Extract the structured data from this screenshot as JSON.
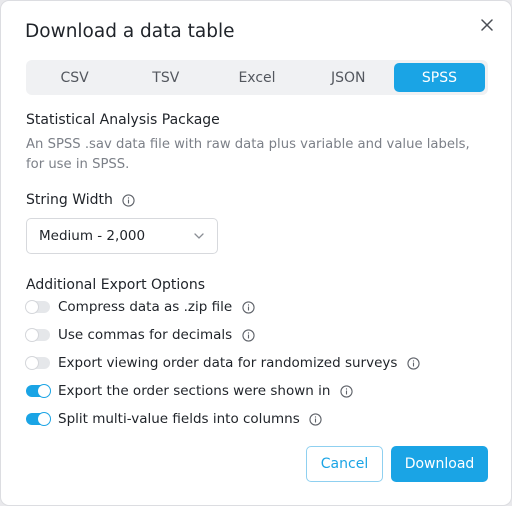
{
  "dialog": {
    "title": "Download a data table",
    "close_icon": "close-icon"
  },
  "tabs": [
    {
      "label": "CSV",
      "active": false
    },
    {
      "label": "TSV",
      "active": false
    },
    {
      "label": "Excel",
      "active": false
    },
    {
      "label": "JSON",
      "active": false
    },
    {
      "label": "SPSS",
      "active": true
    }
  ],
  "format": {
    "title": "Statistical Analysis Package",
    "description": "An SPSS .sav data file with raw data plus variable and value labels, for use in SPSS."
  },
  "string_width": {
    "label": "String Width",
    "selected": "Medium - 2,000"
  },
  "export_options": {
    "title": "Additional Export Options",
    "items": [
      {
        "label": "Compress data as .zip file",
        "on": false
      },
      {
        "label": "Use commas for decimals",
        "on": false
      },
      {
        "label": "Export viewing order data for randomized surveys",
        "on": false
      },
      {
        "label": "Export the order sections were shown in",
        "on": true
      },
      {
        "label": "Split multi-value fields into columns",
        "on": true
      }
    ]
  },
  "buttons": {
    "cancel": "Cancel",
    "download": "Download"
  },
  "colors": {
    "accent": "#1aa4e5",
    "toggle_off": "#e5e7ea"
  }
}
